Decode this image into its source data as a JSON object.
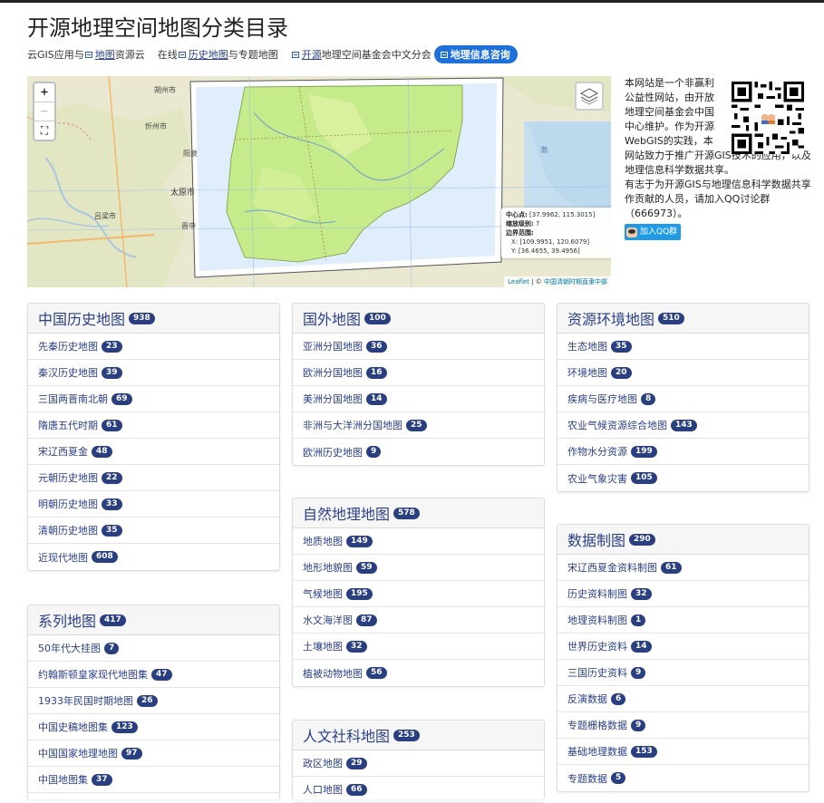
{
  "header": {
    "title": "开源地理空间地图分类目录",
    "sub_1": "云GIS应用与",
    "sub_2": "地图",
    "sub_3": "资源云",
    "sub_4": "在线",
    "sub_5": "历史地图",
    "sub_6": "与专题地图",
    "sub_7": "开源",
    "sub_8": "地理空间基金会中文分会",
    "consult": "地理信息咨询"
  },
  "map": {
    "zoom_in": "+",
    "zoom_out": "−",
    "fullscreen": "⛶",
    "labels": [
      "朔州市",
      "忻州市",
      "太原市",
      "吕梁市",
      "阳泉",
      "晋中",
      "渤"
    ],
    "info": {
      "center_label": "中心点:",
      "center_value": "[37.9962, 115.3015]",
      "zoom_label": "缩放级别:",
      "zoom_value": "7",
      "bounds_label": "边界范围:",
      "bounds_x": "X: [109.9951, 120.6079]",
      "bounds_y": "Y: [36.4655, 39.4956]"
    },
    "attribution_leaflet": "Leaflet",
    "attribution_sep": " | © ",
    "attribution_source": "中国清朝时期直隶中部"
  },
  "about": {
    "intro": "本网站是一个非赢利公益性网站，由开放地理空间基金会中国中心维护。作为开源WebGIS的实践，本",
    "intro2": "网站致力于推广开源GIS技术的应用，以及地理信息科学数据共享。",
    "p2": "有志于为开源GIS与地理信息科学数据共享作贡献的人员，请加入QQ讨论群（666973）。",
    "qq_button": "加入QQ群"
  },
  "panels": {
    "history": {
      "title": "中国历史地图",
      "count": "938",
      "items": [
        {
          "label": "先秦历史地图",
          "count": "23"
        },
        {
          "label": "秦汉历史地图",
          "count": "39"
        },
        {
          "label": "三国两晋南北朝",
          "count": "69"
        },
        {
          "label": "隋唐五代时期",
          "count": "61"
        },
        {
          "label": "宋辽西夏金",
          "count": "48"
        },
        {
          "label": "元朝历史地图",
          "count": "22"
        },
        {
          "label": "明朝历史地图",
          "count": "33"
        },
        {
          "label": "清朝历史地图",
          "count": "35"
        },
        {
          "label": "近现代地图",
          "count": "608"
        }
      ]
    },
    "series": {
      "title": "系列地图",
      "count": "417",
      "items": [
        {
          "label": "50年代大挂图",
          "count": "7"
        },
        {
          "label": "约翰斯顿皇家现代地图集",
          "count": "47"
        },
        {
          "label": "1933年民国时期地图",
          "count": "26"
        },
        {
          "label": "中国史稿地图集",
          "count": "123"
        },
        {
          "label": "中国国家地理地图",
          "count": "97"
        },
        {
          "label": "中国地图集",
          "count": "37"
        }
      ]
    },
    "foreign": {
      "title": "国外地图",
      "count": "100",
      "items": [
        {
          "label": "亚洲分国地图",
          "count": "36"
        },
        {
          "label": "欧洲分国地图",
          "count": "16"
        },
        {
          "label": "美洲分国地图",
          "count": "14"
        },
        {
          "label": "非洲与大洋洲分国地图",
          "count": "25"
        },
        {
          "label": "欧洲历史地图",
          "count": "9"
        }
      ]
    },
    "nature": {
      "title": "自然地理地图",
      "count": "578",
      "items": [
        {
          "label": "地质地图",
          "count": "149"
        },
        {
          "label": "地形地貌图",
          "count": "59"
        },
        {
          "label": "气候地图",
          "count": "195"
        },
        {
          "label": "水文海洋图",
          "count": "87"
        },
        {
          "label": "土壤地图",
          "count": "32"
        },
        {
          "label": "植被动物地图",
          "count": "56"
        }
      ]
    },
    "humanities": {
      "title": "人文社科地图",
      "count": "253",
      "items": [
        {
          "label": "政区地图",
          "count": "29"
        },
        {
          "label": "人口地图",
          "count": "66"
        }
      ]
    },
    "environment": {
      "title": "资源环境地图",
      "count": "510",
      "items": [
        {
          "label": "生态地图",
          "count": "35"
        },
        {
          "label": "环境地图",
          "count": "20"
        },
        {
          "label": "疾病与医疗地图",
          "count": "8"
        },
        {
          "label": "农业气候资源综合地图",
          "count": "143"
        },
        {
          "label": "作物水分资源",
          "count": "199"
        },
        {
          "label": "农业气象灾害",
          "count": "105"
        }
      ]
    },
    "data": {
      "title": "数据制图",
      "count": "290",
      "items": [
        {
          "label": "宋辽西夏金资料制图",
          "count": "61"
        },
        {
          "label": "历史资料制图",
          "count": "32"
        },
        {
          "label": "地理资料制图",
          "count": "1"
        },
        {
          "label": "世界历史资料",
          "count": "14"
        },
        {
          "label": "三国历史资料",
          "count": "9"
        },
        {
          "label": "反演数据",
          "count": "6"
        },
        {
          "label": "专题栅格数据",
          "count": "9"
        },
        {
          "label": "基础地理数据",
          "count": "153"
        },
        {
          "label": "专题数据",
          "count": "5"
        }
      ]
    }
  },
  "colors": {
    "accent": "#2a3f80",
    "link": "#2b3f86",
    "pill": "#1f6fd9",
    "map_land": "#e9ead2",
    "map_overlay": "#c8e98a"
  }
}
